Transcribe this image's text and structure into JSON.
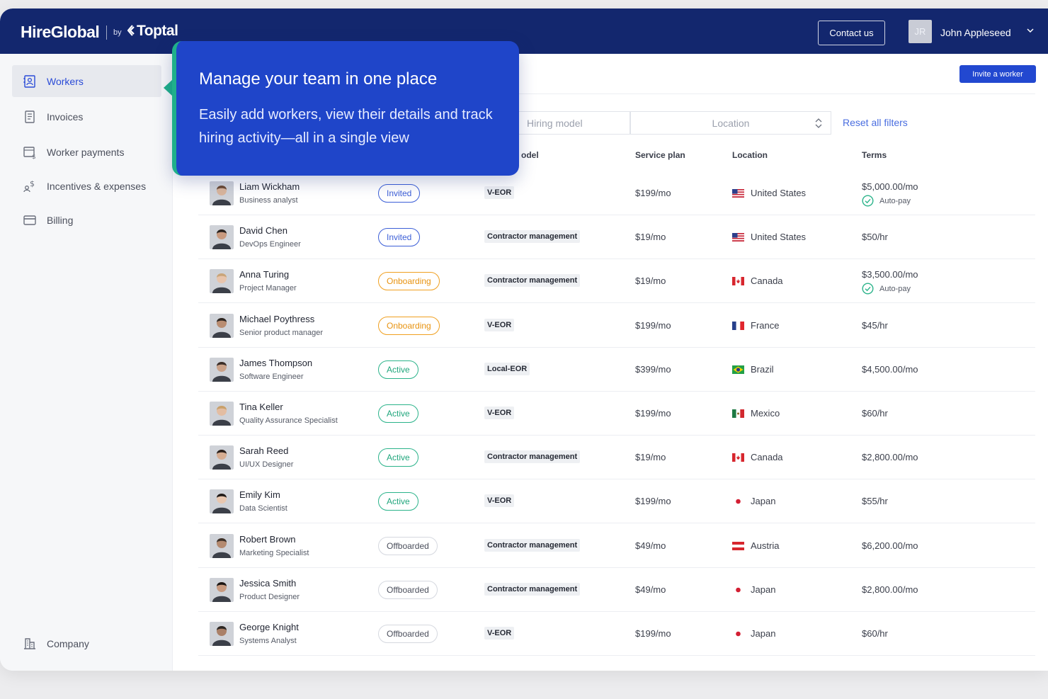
{
  "header": {
    "logo_main": "HireGlobal",
    "logo_by": "by",
    "logo_partner": "Toptal",
    "contact_label": "Contact us",
    "user_initials": "JR",
    "user_name": "John Appleseed"
  },
  "sidebar": {
    "items": [
      {
        "label": "Workers",
        "icon": "workers-icon",
        "active": true
      },
      {
        "label": "Invoices",
        "icon": "invoice-icon",
        "active": false
      },
      {
        "label": "Worker payments",
        "icon": "payments-icon",
        "active": false
      },
      {
        "label": "Incentives & expenses",
        "icon": "incentives-icon",
        "active": false
      },
      {
        "label": "Billing",
        "icon": "card-icon",
        "active": false
      }
    ],
    "company_label": "Company"
  },
  "toolbar": {
    "invite_label": "Invite a worker",
    "hiring_placeholder": "Hiring model",
    "location_placeholder": "Location",
    "reset_label": "Reset all filters"
  },
  "tooltip": {
    "title": "Manage your team in one place",
    "body": "Easily add workers, view their details and track hiring activity—all in a single view"
  },
  "table": {
    "columns": {
      "model": "odel",
      "plan": "Service plan",
      "location": "Location",
      "terms": "Terms"
    },
    "rows": [
      {
        "name": "Liam Wickham",
        "role": "Business analyst",
        "status": "Invited",
        "model": "V-EOR",
        "plan": "$199/mo",
        "country": "United States",
        "flag": "us",
        "terms": "$5,000.00/mo",
        "autopay": "Auto-pay"
      },
      {
        "name": "David Chen",
        "role": "DevOps Engineer",
        "status": "Invited",
        "model": "Contractor management",
        "plan": "$19/mo",
        "country": "United States",
        "flag": "us",
        "terms": "$50/hr"
      },
      {
        "name": "Anna Turing",
        "role": "Project Manager",
        "status": "Onboarding",
        "model": "Contractor management",
        "plan": "$19/mo",
        "country": "Canada",
        "flag": "ca",
        "terms": "$3,500.00/mo",
        "autopay": "Auto-pay"
      },
      {
        "name": "Michael Poythress",
        "role": "Senior product manager",
        "status": "Onboarding",
        "model": "V-EOR",
        "plan": "$199/mo",
        "country": "France",
        "flag": "fr",
        "terms": "$45/hr"
      },
      {
        "name": "James Thompson",
        "role": "Software Engineer",
        "status": "Active",
        "model": "Local-EOR",
        "plan": "$399/mo",
        "country": "Brazil",
        "flag": "br",
        "terms": "$4,500.00/mo"
      },
      {
        "name": "Tina Keller",
        "role": "Quality Assurance Specialist",
        "status": "Active",
        "model": "V-EOR",
        "plan": "$199/mo",
        "country": "Mexico",
        "flag": "mx",
        "terms": "$60/hr"
      },
      {
        "name": "Sarah Reed",
        "role": "UI/UX Designer",
        "status": "Active",
        "model": "Contractor management",
        "plan": "$19/mo",
        "country": "Canada",
        "flag": "ca",
        "terms": "$2,800.00/mo"
      },
      {
        "name": "Emily Kim",
        "role": "Data Scientist",
        "status": "Active",
        "model": "V-EOR",
        "plan": "$199/mo",
        "country": "Japan",
        "flag": "jp",
        "terms": "$55/hr"
      },
      {
        "name": "Robert Brown",
        "role": "Marketing Specialist",
        "status": "Offboarded",
        "model": "Contractor management",
        "plan": "$49/mo",
        "country": "Austria",
        "flag": "at",
        "terms": "$6,200.00/mo"
      },
      {
        "name": "Jessica Smith",
        "role": "Product Designer",
        "status": "Offboarded",
        "model": "Contractor management",
        "plan": "$49/mo",
        "country": "Japan",
        "flag": "jp",
        "terms": "$2,800.00/mo"
      },
      {
        "name": "George Knight",
        "role": "Systems Analyst",
        "status": "Offboarded",
        "model": "V-EOR",
        "plan": "$199/mo",
        "country": "Japan",
        "flag": "jp",
        "terms": "$60/hr"
      }
    ]
  },
  "colors": {
    "header_bg": "#13276e",
    "accent": "#2248d0",
    "invited": "#3c5fd7",
    "onboarding": "#f0a020",
    "active": "#2bb38a",
    "offboarded": "#d5d8df"
  }
}
